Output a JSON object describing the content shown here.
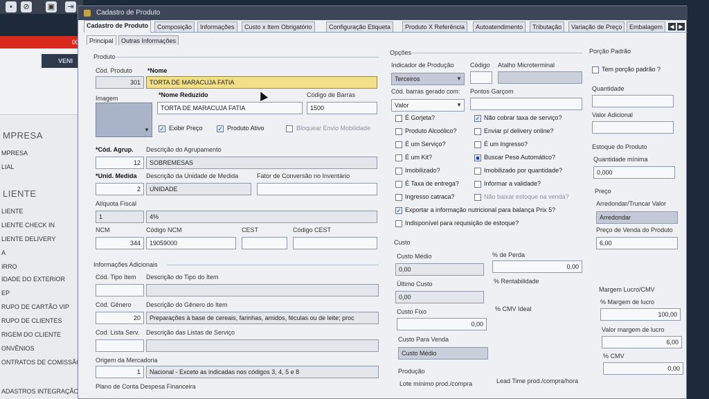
{
  "app": {
    "red_bar_text": "00",
    "banner_tab": "VENI",
    "sidebar": {
      "group1": "MPRESA",
      "group1_items": [
        "MPRESA",
        "LIAL"
      ],
      "group2": "LIENTE",
      "group2_items": [
        "LIENTE",
        "LIENTE CHECK IN",
        "LIENTE DELIVERY",
        "A",
        "IRRO",
        "IDADE DO EXTERIOR",
        "EP",
        "RUPO DE CARTÃO VIP",
        "RUPO DE CLIENTES",
        "RIGEM DO CLIENTE",
        "ONVÊNIOS",
        "ONTRATOS DE COMISSÃO"
      ],
      "bottom_item": "ADASTROS INTEGRAÇÃO"
    }
  },
  "dialog": {
    "title": "Cadastro de Produto",
    "tabs": [
      "Cadastro de Produto",
      "Composição",
      "Informações",
      "Custo x Item Obrigatório",
      "Configuração Etiqueta",
      "Produto X Referência",
      "Autoatendimento",
      "Tributação",
      "Variação de Preço",
      "Embalagem"
    ],
    "subtabs": [
      "Principal",
      "Outras Informações"
    ]
  },
  "produto": {
    "group_title": "Produto",
    "cod_produto_label": "Cód. Produto",
    "cod_produto": "301",
    "nome_label": "*Nome",
    "nome": "TORTA DE MARACUJA FATIA",
    "imagem_label": "Imagem",
    "nome_reduzido_label": "*Nome Reduzido",
    "nome_reduzido": "TORTA DE MARACUJA FATIA",
    "codigo_barras_label": "Código de Barras",
    "codigo_barras": "1500",
    "exibir_preco": "Exibir Preço",
    "produto_ativo": "Produto Ativo",
    "bloquear_envio": "Bloquear Envio Mobilidade",
    "cod_agrup_label": "*Cód. Agrup.",
    "cod_agrup": "12",
    "desc_agrup_label": "Descrição do Agrupamento",
    "desc_agrup": "SOBREMESAS",
    "unid_medida_label": "*Unid. Medida",
    "unid_medida": "2",
    "desc_unid_label": "Descrição da Unidade de Medida",
    "desc_unid": "UNIDADE",
    "fator_label": "Fator de Conversão no Inventário",
    "aliquota_label": "Alíquota Fiscal",
    "aliquota_cod": "1",
    "aliquota_desc": "4%",
    "ncm_label": "NCM",
    "ncm": "344",
    "codigo_ncm_label": "Código NCM",
    "codigo_ncm": "19059000",
    "cest_label": "CEST",
    "codigo_cest_label": "Código CEST"
  },
  "info_adicionais": {
    "group_title": "Informações Adicionais",
    "tipo_item_label": "Cód. Tipo Item",
    "desc_tipo_label": "Descrição do Tipo do Item",
    "genero_label": "Cód. Gênero",
    "genero": "20",
    "desc_genero_label": "Descrição do Gênero do Item",
    "desc_genero": "Preparações à base de cereais, farinhas, amidos, féculas ou de leite; proc",
    "lista_serv_label": "Cod. Lista Serv.",
    "desc_lista_label": "Descrição das Listas de Serviço",
    "origem_label": "Origem da Mercadoria",
    "origem": "1",
    "origem_desc": "Nacional - Exceto as indicadas nos códigos 3, 4, 5 e 8",
    "plano_label": "Plano de Conta Despesa Financeira"
  },
  "opcoes": {
    "group_title": "Opções",
    "indicador_label": "Indicador de Produção",
    "indicador": "Terceiros",
    "codigo_label": "Código",
    "atalho_label": "Atalho Microterminal",
    "barras_gerado_label": "Cód. barras gerado com:",
    "barras_gerado": "Valor",
    "pontos_label": "Pontos Garçom",
    "checks_left": [
      "É Gorjeta?",
      "Produto Alcoólico?",
      "É um Serviço?",
      "É um Kit?",
      "Imobilizado?",
      "É Taxa de entrega?",
      "Ingresso catraca?",
      "Exportar a informação nutricional para balança Prix 5?",
      "Indisponível para requisição de estoque?"
    ],
    "checks_right": [
      "Não cobrar taxa de serviço?",
      "Enviar p/ delivery online?",
      "É um Ingresso?",
      "Buscar Peso Automático?",
      "Imobilizado por quantidade?",
      "Informar a validade?",
      "Não baixar estoque na venda?"
    ]
  },
  "custo": {
    "group_title": "Custo",
    "custo_medio_label": "Custo Médio",
    "custo_medio": "0,00",
    "perda_label": "% de Perda",
    "perda": "0,00",
    "ultimo_label": "Último Custo",
    "ultimo": "0,00",
    "rentab_label": "% Rentabilidade",
    "custo_fixo_label": "Custo Fixo",
    "custo_fixo": "0,00",
    "cmv_ideal_label": "% CMV Ideal",
    "custo_venda_label": "Custo Para Venda",
    "custo_venda": "Custo Médio"
  },
  "producao": {
    "group_title": "Produção",
    "lote_label": "Lote mínimo prod./compra",
    "lead_label": "Lead Time prod./compra/hora"
  },
  "porcao": {
    "group_title": "Porção Padrão",
    "tem_porcao": "Tem porção padrão ?",
    "quantidade_label": "Quantidade",
    "valor_adicional_label": "Valor Adicional"
  },
  "estoque": {
    "group_title": "Estoque do Produto",
    "qtd_min_label": "Quantidade mínima",
    "qtd_min": "0,000"
  },
  "preco": {
    "group_title": "Preço",
    "arred_label": "Arredondar/Truncar Valor",
    "arred": "Arredondar",
    "preco_venda_label": "Preço de Venda do Produto",
    "preco_venda": "6,00",
    "margem_cmv_label": "Margem Lucro/CMV",
    "margem_lucro_label": "% Margem de lucro",
    "margem_lucro": "100,00",
    "valor_margem_label": "Valor margem de lucro",
    "valor_margem": "6,00",
    "cmv_label": "% CMV",
    "cmv": "0,00"
  }
}
